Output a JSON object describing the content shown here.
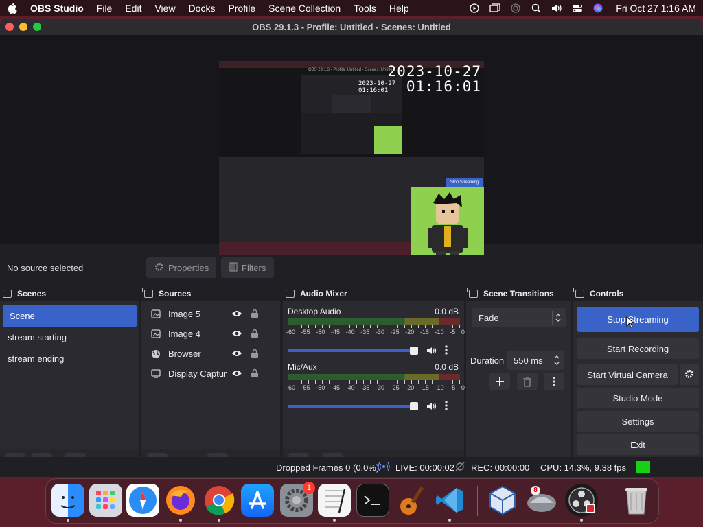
{
  "menubar": {
    "app_name": "OBS Studio",
    "items": [
      "File",
      "Edit",
      "View",
      "Docks",
      "Profile",
      "Scene Collection",
      "Tools",
      "Help"
    ],
    "clock": "Fri Oct 27  1:16 AM"
  },
  "window": {
    "title": "OBS 29.1.3 - Profile: Untitled - Scenes: Untitled"
  },
  "preview": {
    "date": "2023-10-27",
    "time": "01:16:01",
    "inner_stop_label": "Stop Streaming"
  },
  "sourcebar": {
    "no_source": "No source selected",
    "properties": "Properties",
    "filters": "Filters"
  },
  "scenes": {
    "title": "Scenes",
    "items": [
      "Scene",
      "stream starting",
      "stream ending"
    ]
  },
  "sources": {
    "title": "Sources",
    "items": [
      {
        "label": "Image 5",
        "icon": "image-icon"
      },
      {
        "label": "Image 4",
        "icon": "image-icon"
      },
      {
        "label": "Browser",
        "icon": "globe-icon"
      },
      {
        "label": "Display Captur",
        "icon": "display-icon"
      }
    ]
  },
  "mixer": {
    "title": "Audio Mixer",
    "scale": [
      "-60",
      "-55",
      "-50",
      "-45",
      "-40",
      "-35",
      "-30",
      "-25",
      "-20",
      "-15",
      "-10",
      "-5",
      "0"
    ],
    "channels": [
      {
        "name": "Desktop Audio",
        "db": "0.0 dB",
        "volume": 1.0
      },
      {
        "name": "Mic/Aux",
        "db": "0.0 dB",
        "volume": 1.0
      }
    ]
  },
  "transitions": {
    "title": "Scene Transitions",
    "selected": "Fade",
    "duration_label": "Duration",
    "duration_value": "550 ms"
  },
  "controls": {
    "title": "Controls",
    "stop_streaming": "Stop Streaming",
    "start_recording": "Start Recording",
    "start_virtual_camera": "Start Virtual Camera",
    "studio_mode": "Studio Mode",
    "settings": "Settings",
    "exit": "Exit"
  },
  "status": {
    "dropped": "Dropped Frames 0 (0.0%)",
    "live": "LIVE: 00:00:02",
    "rec": "REC: 00:00:00",
    "cpu": "CPU: 14.3%, 9.38 fps"
  },
  "dock": {
    "settings_badge": "1",
    "vbox_badge": "8"
  },
  "colors": {
    "accent": "#3a63c9",
    "live_indicator": "#16d116",
    "preview_green": "#8fd14f"
  }
}
